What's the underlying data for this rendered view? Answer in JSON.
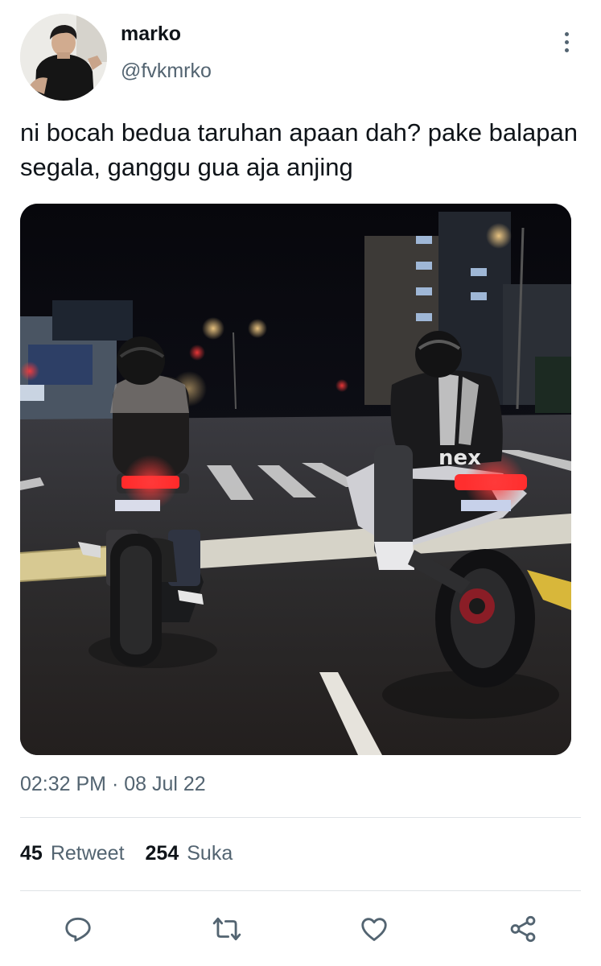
{
  "tweet": {
    "author": {
      "display_name": "marko",
      "handle": "@fvkmrko"
    },
    "text": "ni bocah bedua taruhan apaan dah? pake balapan segala, ganggu gua aja anjing",
    "timestamp": "02:32 PM · 08 Jul 22",
    "stats": {
      "retweets_count": "45",
      "retweets_label": "Retweet",
      "likes_count": "254",
      "likes_label": "Suka"
    }
  },
  "media_text": {
    "jacket_brand": "nex"
  },
  "icons": {
    "more": "more-vertical-icon",
    "reply": "reply-icon",
    "retweet": "retweet-icon",
    "like": "heart-icon",
    "share": "share-icon"
  },
  "colors": {
    "primary_text": "#0f1419",
    "secondary_text": "#536471",
    "divider": "#dfe3e6"
  }
}
